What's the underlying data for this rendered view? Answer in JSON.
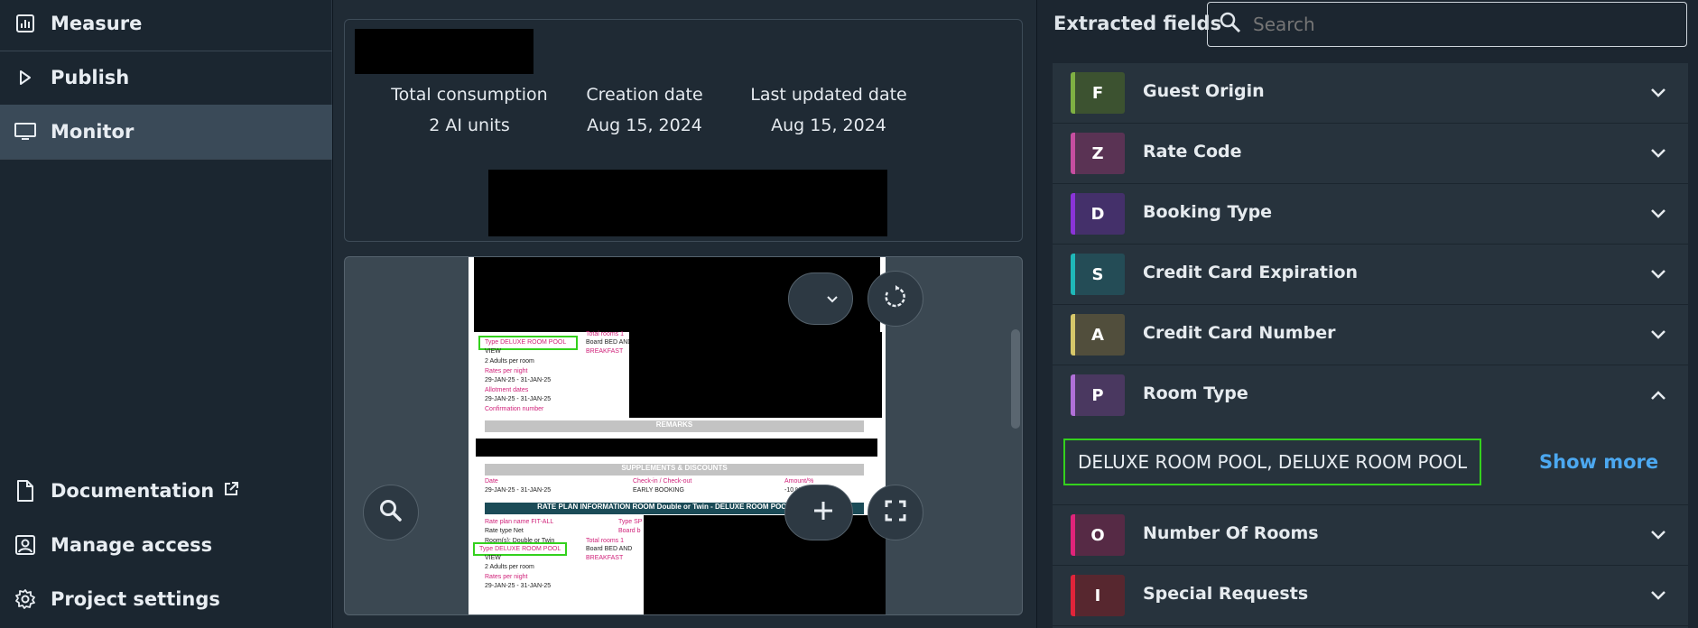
{
  "sidebar": {
    "items": [
      {
        "label": "Measure",
        "icon": "bar-chart-icon"
      },
      {
        "label": "Publish",
        "icon": "play-icon"
      },
      {
        "label": "Monitor",
        "icon": "monitor-icon"
      }
    ],
    "bottom": [
      {
        "label": "Documentation",
        "icon": "document-icon",
        "external": "external-link-icon"
      },
      {
        "label": "Manage access",
        "icon": "manage-access-icon"
      },
      {
        "label": "Project settings",
        "icon": "gear-icon"
      }
    ]
  },
  "summary": {
    "total_consumption_label": "Total consumption",
    "total_consumption_value": "2 AI units",
    "creation_date_label": "Creation date",
    "creation_date_value": "Aug 15, 2024",
    "last_updated_label": "Last updated date",
    "last_updated_value": "Aug 15, 2024"
  },
  "document": {
    "total_rooms": "Total rooms 1",
    "type_room": "Type DELUXE ROOM POOL",
    "view": "VIEW",
    "board": "Board BED AND",
    "breakfast": "BREAKFAST",
    "adults": "2 Adults per room",
    "rates": "Rates per night",
    "dates": "29-JAN-25 - 31-JAN-25",
    "allotment": "Allotment dates",
    "confirmation": "Confirmation number",
    "remarks": "REMARKS",
    "supplements": "SUPPLEMENTS & DISCOUNTS",
    "date_hdr": "Date",
    "checkin_hdr": "Check-in / Check-out",
    "amount_hdr": "Amount/%",
    "early_booking": "EARLY BOOKING",
    "pct": "-10 %",
    "rate_plan_bar": "RATE PLAN INFORMATION ROOM Double or Twin - DELUXE ROOM POOL VIEW",
    "rate_plan_name": "Rate plan name FIT-ALL",
    "rate_type": "Rate type Net",
    "rooms": "Room(s): Double or Twin",
    "type_sp": "Type SP",
    "board_short": "Board b"
  },
  "right_panel": {
    "title": "Extracted fields",
    "search_placeholder": "Search",
    "fields": [
      {
        "letter": "F",
        "label": "Guest Origin",
        "color": "#7fb043",
        "bg": "#3c5230"
      },
      {
        "letter": "Z",
        "label": "Rate Code",
        "color": "#c64ea0",
        "bg": "#5a3354"
      },
      {
        "letter": "D",
        "label": "Booking Type",
        "color": "#8a34d8",
        "bg": "#44306a"
      },
      {
        "letter": "S",
        "label": "Credit Card Expiration",
        "color": "#1fb8b8",
        "bg": "#244c56"
      },
      {
        "letter": "A",
        "label": "Credit Card Number",
        "color": "#d6c76a",
        "bg": "#514e3c"
      },
      {
        "letter": "P",
        "label": "Room Type",
        "color": "#b070d8",
        "bg": "#4a3860",
        "expanded": true
      },
      {
        "letter": "O",
        "label": "Number Of Rooms",
        "color": "#e0247a",
        "bg": "#562a45"
      },
      {
        "letter": "I",
        "label": "Special Requests",
        "color": "#e0243a",
        "bg": "#57272f"
      }
    ],
    "room_type_value": "DELUXE ROOM POOL, DELUXE ROOM POOL",
    "show_more": "Show more"
  }
}
